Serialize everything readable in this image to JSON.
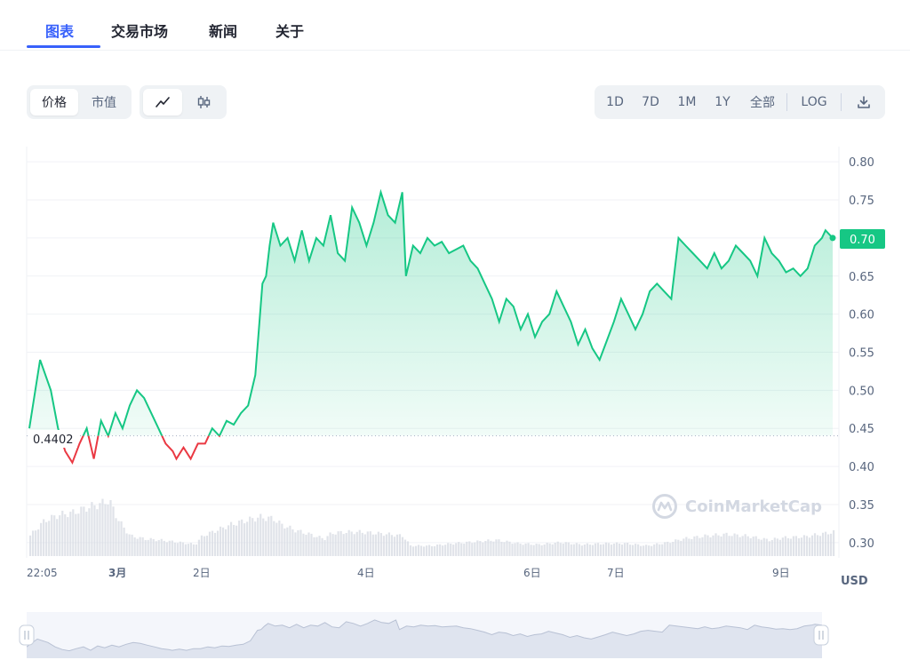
{
  "tabs": [
    {
      "label": "图表",
      "active": true
    },
    {
      "label": "交易市场",
      "active": false
    },
    {
      "label": "新闻",
      "active": false
    },
    {
      "label": "关于",
      "active": false
    }
  ],
  "toolbar": {
    "metric": {
      "price": "价格",
      "market_cap": "市值",
      "selected": "价格"
    },
    "chart_type": {
      "line_icon": "line-chart-icon",
      "candle_icon": "candlestick-icon",
      "selected": "line"
    },
    "ranges": [
      "1D",
      "7D",
      "1M",
      "1Y",
      "全部"
    ],
    "log_label": "LOG",
    "download_icon": "download-icon"
  },
  "chart_data": {
    "type": "area",
    "currency": "USD",
    "ylim": [
      0.28,
      0.82
    ],
    "y_ticks": [
      "0.80",
      "0.75",
      "0.70",
      "0.65",
      "0.60",
      "0.55",
      "0.50",
      "0.45",
      "0.40",
      "0.35",
      "0.30"
    ],
    "x_ticks": [
      "22:05",
      "3月",
      "2日",
      "4日",
      "6日",
      "7日",
      "9日"
    ],
    "baseline_value": 0.4402,
    "baseline_label": "0.4402",
    "current_price": 0.7,
    "current_price_label": "0.70",
    "colors": {
      "up": "#16c784",
      "down": "#ea3943",
      "volume": "#d5dae2"
    },
    "watermark": "CoinMarketCap",
    "unit_label": "USD",
    "price_points": [
      [
        0,
        0.45
      ],
      [
        3,
        0.54
      ],
      [
        6,
        0.5
      ],
      [
        8,
        0.45
      ],
      [
        10,
        0.42
      ],
      [
        12,
        0.405
      ],
      [
        14,
        0.43
      ],
      [
        16,
        0.45
      ],
      [
        18,
        0.41
      ],
      [
        20,
        0.46
      ],
      [
        22,
        0.44
      ],
      [
        24,
        0.47
      ],
      [
        26,
        0.45
      ],
      [
        28,
        0.48
      ],
      [
        30,
        0.5
      ],
      [
        32,
        0.49
      ],
      [
        34,
        0.47
      ],
      [
        36,
        0.45
      ],
      [
        38,
        0.43
      ],
      [
        40,
        0.42
      ],
      [
        41,
        0.41
      ],
      [
        43,
        0.425
      ],
      [
        45,
        0.41
      ],
      [
        47,
        0.43
      ],
      [
        49,
        0.43
      ],
      [
        51,
        0.45
      ],
      [
        53,
        0.44
      ],
      [
        55,
        0.46
      ],
      [
        57,
        0.455
      ],
      [
        59,
        0.47
      ],
      [
        61,
        0.48
      ],
      [
        63,
        0.52
      ],
      [
        64,
        0.58
      ],
      [
        65,
        0.64
      ],
      [
        66,
        0.65
      ],
      [
        67,
        0.69
      ],
      [
        68,
        0.72
      ],
      [
        70,
        0.69
      ],
      [
        72,
        0.7
      ],
      [
        74,
        0.67
      ],
      [
        76,
        0.71
      ],
      [
        78,
        0.67
      ],
      [
        80,
        0.7
      ],
      [
        82,
        0.69
      ],
      [
        84,
        0.73
      ],
      [
        86,
        0.68
      ],
      [
        88,
        0.67
      ],
      [
        90,
        0.74
      ],
      [
        92,
        0.72
      ],
      [
        94,
        0.69
      ],
      [
        96,
        0.72
      ],
      [
        98,
        0.76
      ],
      [
        100,
        0.73
      ],
      [
        102,
        0.72
      ],
      [
        104,
        0.76
      ],
      [
        105,
        0.65
      ],
      [
        107,
        0.69
      ],
      [
        109,
        0.68
      ],
      [
        111,
        0.7
      ],
      [
        113,
        0.69
      ],
      [
        115,
        0.695
      ],
      [
        117,
        0.68
      ],
      [
        119,
        0.685
      ],
      [
        121,
        0.69
      ],
      [
        123,
        0.67
      ],
      [
        125,
        0.66
      ],
      [
        127,
        0.64
      ],
      [
        129,
        0.62
      ],
      [
        131,
        0.59
      ],
      [
        133,
        0.62
      ],
      [
        135,
        0.61
      ],
      [
        137,
        0.58
      ],
      [
        139,
        0.6
      ],
      [
        141,
        0.57
      ],
      [
        143,
        0.59
      ],
      [
        145,
        0.6
      ],
      [
        147,
        0.63
      ],
      [
        149,
        0.61
      ],
      [
        151,
        0.59
      ],
      [
        153,
        0.56
      ],
      [
        155,
        0.58
      ],
      [
        157,
        0.555
      ],
      [
        159,
        0.54
      ],
      [
        161,
        0.565
      ],
      [
        163,
        0.59
      ],
      [
        165,
        0.62
      ],
      [
        167,
        0.6
      ],
      [
        169,
        0.58
      ],
      [
        171,
        0.6
      ],
      [
        173,
        0.63
      ],
      [
        175,
        0.64
      ],
      [
        177,
        0.63
      ],
      [
        179,
        0.62
      ],
      [
        181,
        0.7
      ],
      [
        183,
        0.69
      ],
      [
        185,
        0.68
      ],
      [
        187,
        0.67
      ],
      [
        189,
        0.66
      ],
      [
        191,
        0.68
      ],
      [
        193,
        0.66
      ],
      [
        195,
        0.67
      ],
      [
        197,
        0.69
      ],
      [
        199,
        0.68
      ],
      [
        201,
        0.67
      ],
      [
        203,
        0.65
      ],
      [
        205,
        0.7
      ],
      [
        207,
        0.68
      ],
      [
        209,
        0.67
      ],
      [
        211,
        0.655
      ],
      [
        213,
        0.66
      ],
      [
        215,
        0.65
      ],
      [
        217,
        0.66
      ],
      [
        219,
        0.69
      ],
      [
        221,
        0.7
      ],
      [
        222,
        0.71
      ],
      [
        224,
        0.7
      ]
    ],
    "volume_points": [
      [
        0,
        0.36
      ],
      [
        4,
        0.62
      ],
      [
        8,
        0.72
      ],
      [
        12,
        0.76
      ],
      [
        16,
        0.85
      ],
      [
        20,
        0.92
      ],
      [
        22,
        0.98
      ],
      [
        24,
        0.7
      ],
      [
        26,
        0.5
      ],
      [
        28,
        0.35
      ],
      [
        32,
        0.3
      ],
      [
        36,
        0.28
      ],
      [
        40,
        0.25
      ],
      [
        44,
        0.22
      ],
      [
        46,
        0.2
      ],
      [
        48,
        0.35
      ],
      [
        52,
        0.45
      ],
      [
        56,
        0.55
      ],
      [
        60,
        0.62
      ],
      [
        64,
        0.68
      ],
      [
        68,
        0.65
      ],
      [
        70,
        0.55
      ],
      [
        74,
        0.45
      ],
      [
        78,
        0.38
      ],
      [
        82,
        0.3
      ],
      [
        84,
        0.4
      ],
      [
        88,
        0.42
      ],
      [
        92,
        0.42
      ],
      [
        96,
        0.4
      ],
      [
        100,
        0.38
      ],
      [
        104,
        0.35
      ],
      [
        106,
        0.18
      ],
      [
        112,
        0.18
      ],
      [
        118,
        0.22
      ],
      [
        124,
        0.25
      ],
      [
        130,
        0.28
      ],
      [
        136,
        0.22
      ],
      [
        142,
        0.2
      ],
      [
        148,
        0.24
      ],
      [
        154,
        0.2
      ],
      [
        160,
        0.22
      ],
      [
        166,
        0.22
      ],
      [
        172,
        0.18
      ],
      [
        178,
        0.24
      ],
      [
        182,
        0.3
      ],
      [
        188,
        0.35
      ],
      [
        194,
        0.38
      ],
      [
        200,
        0.35
      ],
      [
        206,
        0.28
      ],
      [
        210,
        0.32
      ],
      [
        216,
        0.34
      ],
      [
        222,
        0.4
      ],
      [
        224,
        0.42
      ]
    ]
  }
}
